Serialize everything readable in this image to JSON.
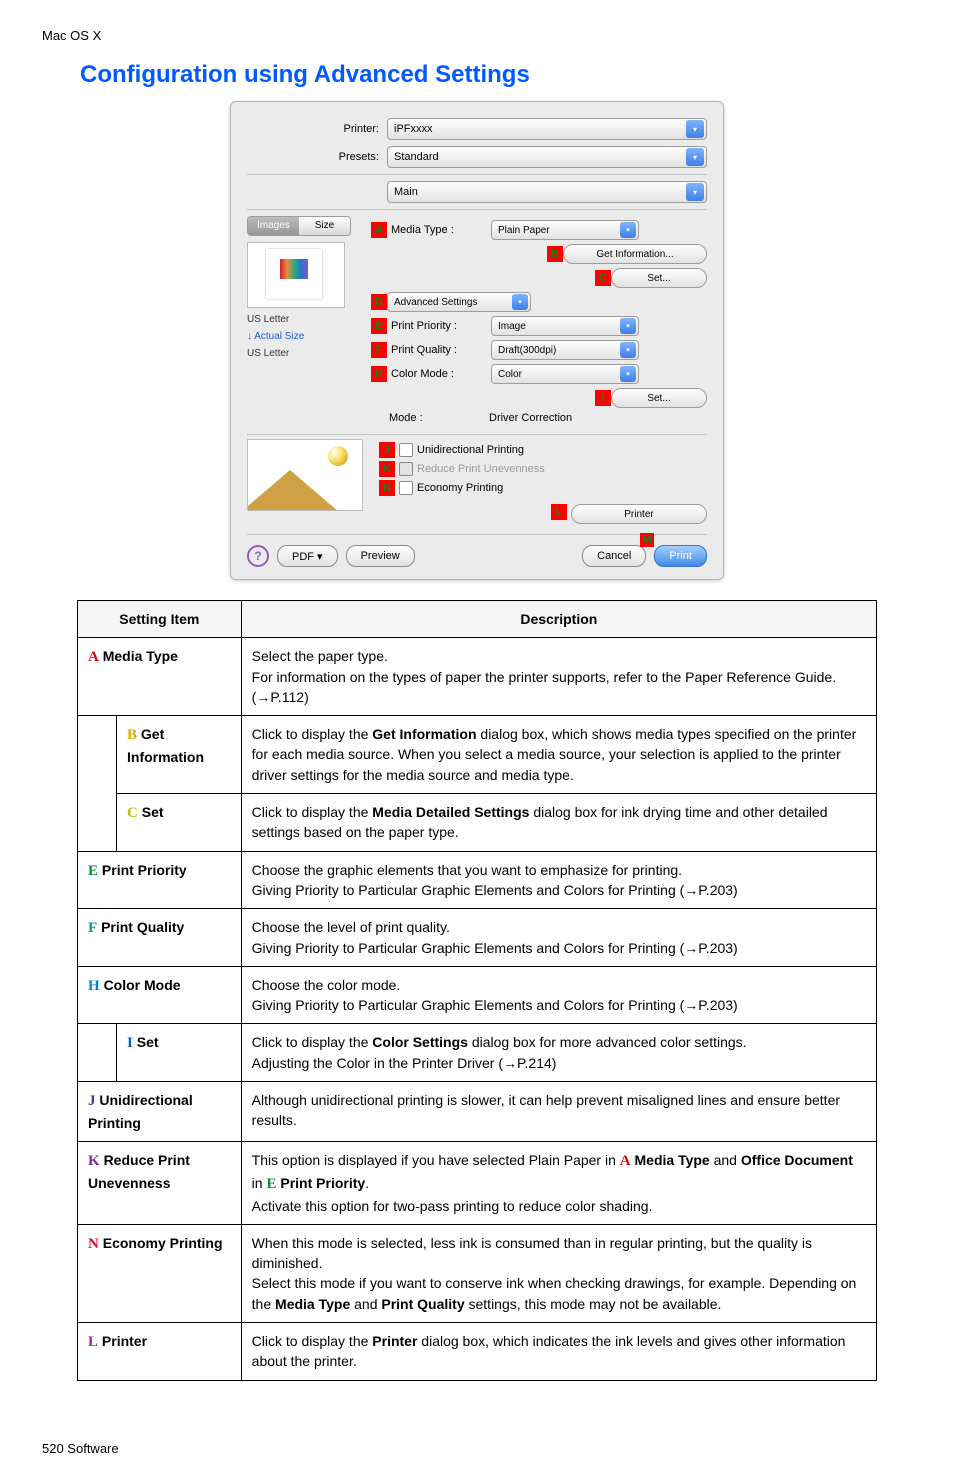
{
  "page_header": "Mac OS X",
  "page_title": "Configuration using Advanced Settings",
  "dialog": {
    "printer_label": "Printer:",
    "printer_value": "iPFxxxx",
    "presets_label": "Presets:",
    "presets_value": "Standard",
    "panel_value": "Main",
    "tabs": {
      "images": "Images",
      "size": "Size"
    },
    "left_info_1": "US Letter",
    "left_info_2_prefix": "↓",
    "left_info_2": "Actual Size",
    "left_info_3": "US Letter",
    "A_label": "Media Type :",
    "A_value": "Plain Paper",
    "B_btn": "Get Information...",
    "C_btn": "Set...",
    "D_label": "Advanced Settings",
    "E_label": "Print Priority :",
    "E_value": "Image",
    "F_label": "Print Quality :",
    "F_value": "Draft(300dpi)",
    "H_label": "Color Mode :",
    "H_value": "Color",
    "I_btn": "Set...",
    "mode_label": "Mode :",
    "mode_value": "Driver Correction",
    "J_chk": "Unidirectional Printing",
    "K_chk": "Reduce Print Unevenness",
    "N_chk": "Economy Printing",
    "L_btn": "Printer",
    "help": "?",
    "pdf_btn": "PDF ▾",
    "preview_btn": "Preview",
    "cancel_btn": "Cancel",
    "print_btn": "Print"
  },
  "table": {
    "head_item": "Setting Item",
    "head_desc": "Description",
    "rows": {
      "A": {
        "name": "Media Type",
        "desc": "Select the paper type.\nFor information on the types of paper the printer supports, refer to the Paper Reference Guide. (→P.112)"
      },
      "B": {
        "name": "Get Information",
        "desc": "Click to display the Get Information dialog box, which shows media types specified on the printer for each media source. When you select a media source, your selection is applied to the printer driver settings for the media source and media type."
      },
      "C": {
        "name": "Set",
        "desc": "Click to display the Media Detailed Settings dialog box for ink drying time and other detailed settings based on the paper type."
      },
      "E": {
        "name": "Print Priority",
        "desc": "Choose the graphic elements that you want to emphasize for printing.\nGiving Priority to Particular Graphic Elements and Colors for Printing (→P.203)"
      },
      "F": {
        "name": "Print Quality",
        "desc": "Choose the level of print quality.\nGiving Priority to Particular Graphic Elements and Colors for Printing (→P.203)"
      },
      "H": {
        "name": "Color Mode",
        "desc": "Choose the color mode.\nGiving Priority to Particular Graphic Elements and Colors for Printing (→P.203)"
      },
      "I": {
        "name": "Set",
        "desc": "Click to display the Color Settings dialog box for more advanced color settings.\nAdjusting the Color in the Printer Driver (→P.214)"
      },
      "J": {
        "name": "Unidirectional Printing",
        "desc": "Although unidirectional printing is slower, it can help prevent misaligned lines and ensure better results."
      },
      "K": {
        "name": "Reduce Print Unevenness",
        "desc_pre": "This option is displayed if you have selected Plain Paper in ",
        "desc_mid": " Media Type",
        "desc_and": " and ",
        "desc_off": "Office Document",
        "desc_in": " in ",
        "desc_pp": " Print Priority",
        "desc_end": ".\nActivate this option for two-pass printing to reduce color shading."
      },
      "N": {
        "name": "Economy Printing",
        "desc": "When this mode is selected, less ink is consumed than in regular printing, but the quality is diminished.\nSelect this mode if you want to conserve ink when checking drawings, for example. Depending on the Media Type and Print Quality settings, this mode may not be available."
      },
      "L": {
        "name": "Printer",
        "desc": "Click to display the Printer dialog box, which indicates the ink levels and gives other information about the printer."
      }
    }
  },
  "footer": "520  Software",
  "letters": {
    "A": "A",
    "B": "B",
    "C": "C",
    "D": "D",
    "E": "E",
    "F": "F",
    "H": "H",
    "I": "I",
    "J": "J",
    "K": "K",
    "L": "L",
    "M": "M",
    "N": "N"
  }
}
